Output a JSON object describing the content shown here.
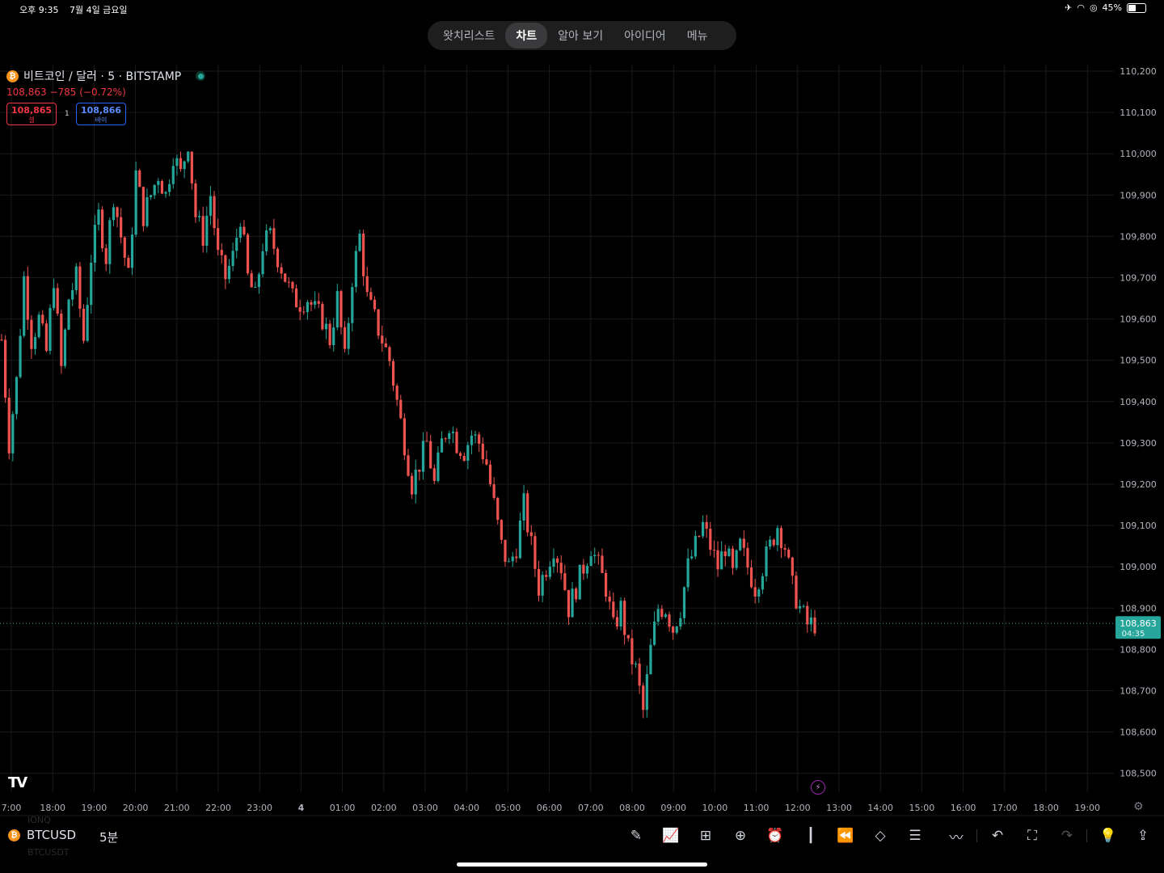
{
  "status_bar": {
    "time": "오후 9:35",
    "date": "7월 4일 금요일",
    "battery": "45%",
    "battery_level": 0.45
  },
  "nav": {
    "tabs": [
      {
        "label": "왓치리스트",
        "active": false
      },
      {
        "label": "차트",
        "active": true
      },
      {
        "label": "알아 보기",
        "active": false
      },
      {
        "label": "아이디어",
        "active": false
      },
      {
        "label": "메뉴",
        "active": false
      }
    ]
  },
  "symbol": {
    "title": "비트코인 / 달러 · 5 · BITSTAMP",
    "price_line": "108,863 −785 (−0.72%)",
    "sell_price": "108,865",
    "sell_label": "셀",
    "buy_price": "108,866",
    "buy_label": "바이",
    "spread": "1"
  },
  "toolbar": {
    "symbol": "BTCUSD",
    "interval": "5분",
    "ghost_above": "IONQ",
    "ghost_below": "BTCUSDT"
  },
  "colors": {
    "up": "#26a69a",
    "down": "#ef5350",
    "background": "#000000",
    "grid": "#1a1a1a"
  },
  "chart_data": {
    "type": "candlestick",
    "y_ticks": [
      "110,200",
      "110,100",
      "110,000",
      "109,900",
      "109,800",
      "109,700",
      "109,600",
      "109,500",
      "109,400",
      "109,300",
      "109,200",
      "109,100",
      "109,000",
      "108,900",
      "108,800",
      "108,700",
      "108,600",
      "108,500"
    ],
    "ylim": [
      108460,
      110220
    ],
    "x_ticks": [
      "7:00",
      "18:00",
      "19:00",
      "20:00",
      "21:00",
      "22:00",
      "23:00",
      "4",
      "01:00",
      "02:00",
      "03:00",
      "04:00",
      "05:00",
      "06:00",
      "07:00",
      "08:00",
      "09:00",
      "10:00",
      "11:00",
      "12:00",
      "13:00",
      "14:00",
      "15:00",
      "16:00",
      "17:00",
      "18:00",
      "19:00"
    ],
    "last_price": "108,863",
    "countdown": "04:35",
    "last_value": 108863,
    "path": [
      109550,
      109300,
      109450,
      109700,
      109550,
      109600,
      109520,
      109700,
      109480,
      109650,
      109700,
      109550,
      109750,
      109850,
      109750,
      109900,
      109800,
      109700,
      109950,
      109850,
      109900,
      109950,
      109900,
      110000,
      109950,
      110030,
      109850,
      109800,
      109900,
      109750,
      109700,
      109750,
      109850,
      109700,
      109650,
      109780,
      109800,
      109750,
      109700,
      109650,
      109640,
      109650,
      109620,
      109600,
      109550,
      109650,
      109500,
      109700,
      109800,
      109650,
      109600,
      109550,
      109500,
      109400,
      109300,
      109200,
      109250,
      109300,
      109200,
      109300,
      109350,
      109300,
      109280,
      109320,
      109300,
      109250,
      109150,
      109050,
      109000,
      109050,
      109150,
      109050,
      108950,
      109000,
      109050,
      109000,
      108900,
      108950,
      109000,
      109050,
      109000,
      108950,
      108850,
      108900,
      108800,
      108750,
      108650,
      108800,
      108900,
      108900,
      108850,
      108900,
      109000,
      109050,
      109100,
      109050,
      109000,
      109050,
      108980,
      109050,
      109000,
      108950,
      109000,
      109050,
      109100,
      109050,
      108950,
      108900,
      108860,
      108863
    ]
  }
}
